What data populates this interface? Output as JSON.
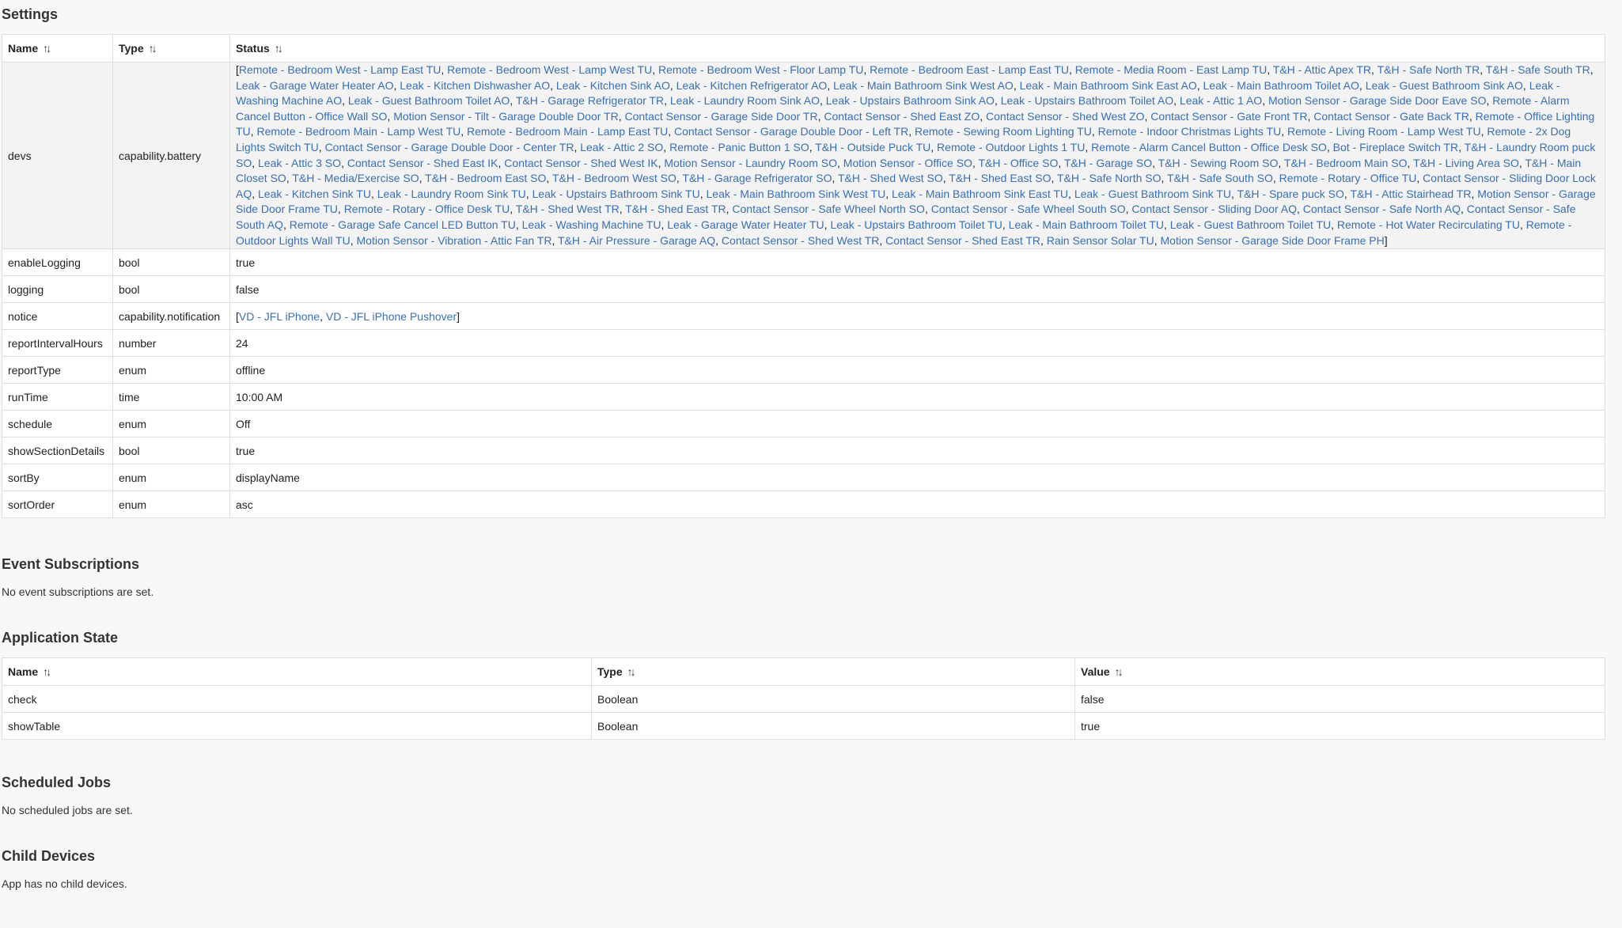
{
  "settings": {
    "title": "Settings",
    "columns": [
      "Name",
      "Type",
      "Status"
    ],
    "devs": {
      "name": "devs",
      "type": "capability.battery",
      "items": [
        "Remote - Bedroom West - Lamp East TU",
        "Remote - Bedroom West - Lamp West TU",
        "Remote - Bedroom West - Floor Lamp TU",
        "Remote - Bedroom East - Lamp East TU",
        "Remote - Media Room - East Lamp TU",
        "T&H - Attic Apex TR",
        "T&H - Safe North TR",
        "T&H - Safe South TR",
        "Leak - Garage Water Heater AO",
        "Leak - Kitchen Dishwasher AO",
        "Leak - Kitchen Sink AO",
        "Leak - Kitchen Refrigerator AO",
        "Leak - Main Bathroom Sink West AO",
        "Leak - Main Bathroom Sink East AO",
        "Leak - Main Bathroom Toilet AO",
        "Leak - Guest Bathroom Sink AO",
        "Leak - Washing Machine AO",
        "Leak - Guest Bathroom Toilet AO",
        "T&H - Garage Refrigerator TR",
        "Leak - Laundry Room Sink AO",
        "Leak - Upstairs Bathroom Sink AO",
        "Leak - Upstairs Bathroom Toilet AO",
        "Leak - Attic 1 AO",
        "Motion Sensor - Garage Side Door Eave SO",
        "Remote - Alarm Cancel Button - Office Wall SO",
        "Motion Sensor - Tilt - Garage Double Door TR",
        "Contact Sensor - Garage Side Door TR",
        "Contact Sensor - Shed East ZO",
        "Contact Sensor - Shed West ZO",
        "Contact Sensor - Gate Front TR",
        "Contact Sensor - Gate Back TR",
        "Remote - Office Lighting TU",
        "Remote - Bedroom Main - Lamp West TU",
        "Remote - Bedroom Main - Lamp East TU",
        "Contact Sensor - Garage Double Door - Left TR",
        "Remote - Sewing Room Lighting TU",
        "Remote - Indoor Christmas Lights TU",
        "Remote - Living Room - Lamp West TU",
        "Remote - 2x Dog Lights Switch TU",
        "Contact Sensor - Garage Double Door - Center TR",
        "Leak - Attic 2 SO",
        "Remote - Panic Button 1 SO",
        "T&H - Outside Puck TU",
        "Remote - Outdoor Lights 1 TU",
        "Remote - Alarm Cancel Button - Office Desk SO",
        "Bot - Fireplace Switch TR",
        "T&H - Laundry Room puck SO",
        "Leak - Attic 3 SO",
        "Contact Sensor - Shed East IK",
        "Contact Sensor - Shed West IK",
        "Motion Sensor - Laundry Room SO",
        "Motion Sensor - Office SO",
        "T&H - Office SO",
        "T&H - Garage SO",
        "T&H - Sewing Room SO",
        "T&H - Bedroom Main SO",
        "T&H - Living Area SO",
        "T&H - Main Closet SO",
        "T&H - Media/Exercise SO",
        "T&H - Bedroom East SO",
        "T&H - Bedroom West SO",
        "T&H - Garage Refrigerator SO",
        "T&H - Shed West SO",
        "T&H - Shed East SO",
        "T&H - Safe North SO",
        "T&H - Safe South SO",
        "Remote - Rotary - Office TU",
        "Contact Sensor - Sliding Door Lock AQ",
        "Leak - Kitchen Sink TU",
        "Leak - Laundry Room Sink TU",
        "Leak - Upstairs Bathroom Sink TU",
        "Leak - Main Bathroom Sink West TU",
        "Leak - Main Bathroom Sink East TU",
        "Leak - Guest Bathroom Sink TU",
        "T&H - Spare puck SO",
        "T&H - Attic Stairhead TR",
        "Motion Sensor - Garage Side Door Frame TU",
        "Remote - Rotary - Office Desk TU",
        "T&H - Shed West TR",
        "T&H - Shed East TR",
        "Contact Sensor - Safe Wheel North SO",
        "Contact Sensor - Safe Wheel South SO",
        "Contact Sensor - Sliding Door AQ",
        "Contact Sensor - Safe North AQ",
        "Contact Sensor - Safe South AQ",
        "Remote - Garage Safe Cancel LED Button TU",
        "Leak - Washing Machine TU",
        "Leak - Garage Water Heater TU",
        "Leak - Upstairs Bathroom Toilet TU",
        "Leak - Main Bathroom Toilet TU",
        "Leak - Guest Bathroom Toilet TU",
        "Remote - Hot Water Recirculating TU",
        "Remote - Outdoor Lights Wall TU",
        "Motion Sensor - Vibration - Attic Fan TR",
        "T&H - Air Pressure - Garage AQ",
        "Contact Sensor - Shed West TR",
        "Contact Sensor - Shed East TR",
        "Rain Sensor Solar TU",
        "Motion Sensor - Garage Side Door Frame PH"
      ]
    },
    "notice": {
      "name": "notice",
      "type": "capability.notification",
      "items": [
        "VD - JFL iPhone",
        "VD - JFL iPhone Pushover"
      ]
    },
    "rows": [
      {
        "name": "enableLogging",
        "type": "bool",
        "status": "true"
      },
      {
        "name": "logging",
        "type": "bool",
        "status": "false"
      },
      {
        "name": "reportIntervalHours",
        "type": "number",
        "status": "24"
      },
      {
        "name": "reportType",
        "type": "enum",
        "status": "offline"
      },
      {
        "name": "runTime",
        "type": "time",
        "status": "10:00 AM"
      },
      {
        "name": "schedule",
        "type": "enum",
        "status": "Off"
      },
      {
        "name": "showSectionDetails",
        "type": "bool",
        "status": "true"
      },
      {
        "name": "sortBy",
        "type": "enum",
        "status": "displayName"
      },
      {
        "name": "sortOrder",
        "type": "enum",
        "status": "asc"
      }
    ]
  },
  "event_subscriptions": {
    "title": "Event Subscriptions",
    "empty": "No event subscriptions are set."
  },
  "application_state": {
    "title": "Application State",
    "columns": [
      "Name",
      "Type",
      "Value"
    ],
    "rows": [
      {
        "name": "check",
        "type": "Boolean",
        "value": "false"
      },
      {
        "name": "showTable",
        "type": "Boolean",
        "value": "true"
      }
    ]
  },
  "scheduled_jobs": {
    "title": "Scheduled Jobs",
    "empty": "No scheduled jobs are set."
  },
  "child_devices": {
    "title": "Child Devices",
    "empty": "App has no child devices."
  },
  "sort_icon": "↑↓",
  "colors": {
    "link": "#3a6fb5",
    "background": "#f8f8f8",
    "border": "#dedede"
  }
}
